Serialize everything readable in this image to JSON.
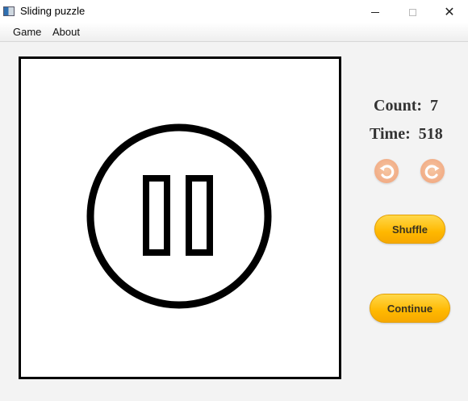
{
  "window": {
    "title": "Sliding puzzle"
  },
  "menu": {
    "items": [
      "Game",
      "About"
    ]
  },
  "stats": {
    "count_label": "Count:",
    "count_value": "7",
    "time_label": "Time:",
    "time_value": "518"
  },
  "controls": {
    "undo_icon": "undo-icon",
    "redo_icon": "redo-icon",
    "shuffle_label": "Shuffle",
    "continue_label": "Continue"
  },
  "board": {
    "state": "paused",
    "overlay_icon": "pause-icon"
  },
  "colors": {
    "button_gold": "#ffb800",
    "arrow_button": "#f2b08a",
    "board_border": "#000000"
  }
}
